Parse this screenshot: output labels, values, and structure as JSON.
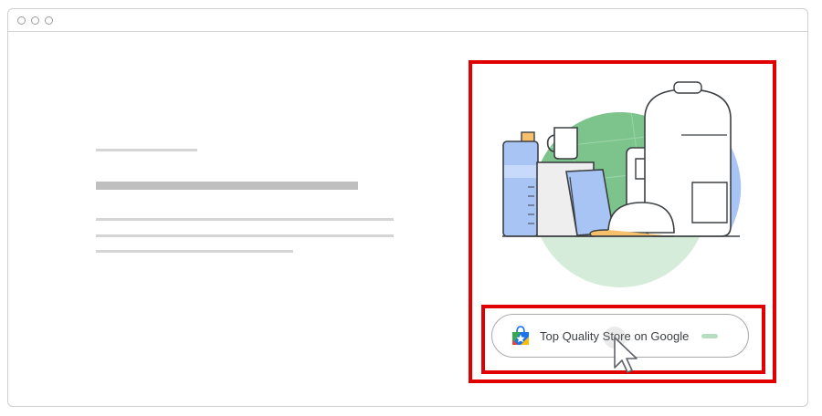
{
  "badge": {
    "label": "Top Quality Store on Google",
    "icon": "shopping-bag-star-icon"
  },
  "colors": {
    "highlight": "#e00000",
    "illustration_green": "#7cc38c",
    "illustration_blue": "#a8c4f5"
  },
  "icons": [
    "window-dot-icon",
    "shopping-bag-star-icon",
    "pointer-cursor-icon"
  ]
}
